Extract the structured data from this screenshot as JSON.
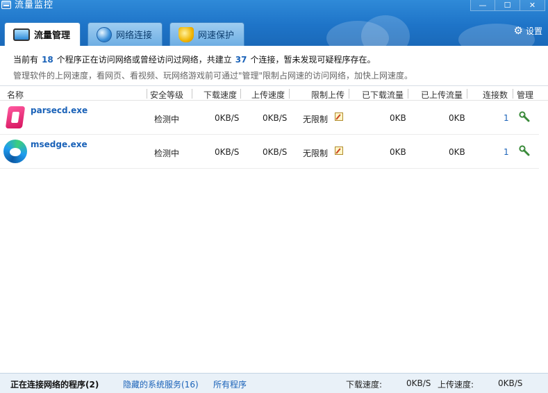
{
  "window": {
    "title": "流量监控",
    "minimize_label": "—",
    "maximize_label": "☐",
    "close_label": "✕"
  },
  "tabs": [
    {
      "label": "流量管理",
      "icon": "monitor-icon",
      "active": true
    },
    {
      "label": "网络连接",
      "icon": "globe-icon",
      "active": false
    },
    {
      "label": "网速保护",
      "icon": "speed-shield-icon",
      "active": false
    }
  ],
  "settings": {
    "label": "设置",
    "icon": "gear-icon"
  },
  "summary": {
    "prefix": "当前有",
    "program_count": "18",
    "middle": "个程序正在访问网络或曾经访问过网络，共建立",
    "connection_count": "37",
    "suffix": "个连接，暂未发现可疑程序存在。",
    "hint": "管理软件的上网速度，看网页、看视频、玩网络游戏前可通过\"管理\"限制占网速的访问网络，加快上网速度。"
  },
  "columns": {
    "name": "名称",
    "security": "安全等级",
    "download_speed": "下载速度",
    "upload_speed": "上传速度",
    "limit_upload": "限制上传",
    "downloaded": "已下载流量",
    "uploaded": "已上传流量",
    "connections": "连接数",
    "manage": "管理"
  },
  "processes": [
    {
      "name": "parsecd.exe",
      "icon": "parsec-app-icon",
      "security": "检测中",
      "download_speed": "0KB/S",
      "upload_speed": "0KB/S",
      "limit": "无限制",
      "downloaded": "0KB",
      "uploaded": "0KB",
      "connections": "1"
    },
    {
      "name": "msedge.exe",
      "icon": "edge-browser-icon",
      "security": "检测中",
      "download_speed": "0KB/S",
      "upload_speed": "0KB/S",
      "limit": "无限制",
      "downloaded": "0KB",
      "uploaded": "0KB",
      "connections": "1"
    }
  ],
  "statusbar": {
    "active_programs": "正在连接网络的程序(2)",
    "hidden_services": "隐藏的系统服务(16)",
    "all_programs": "所有程序",
    "download_label": "下载速度:",
    "download_value": "0KB/S",
    "upload_label": "上传速度:",
    "upload_value": "0KB/S"
  },
  "colors": {
    "header_blue": "#1e74c8",
    "link_blue": "#1a62b8",
    "status_bg": "#e9f1f8"
  }
}
